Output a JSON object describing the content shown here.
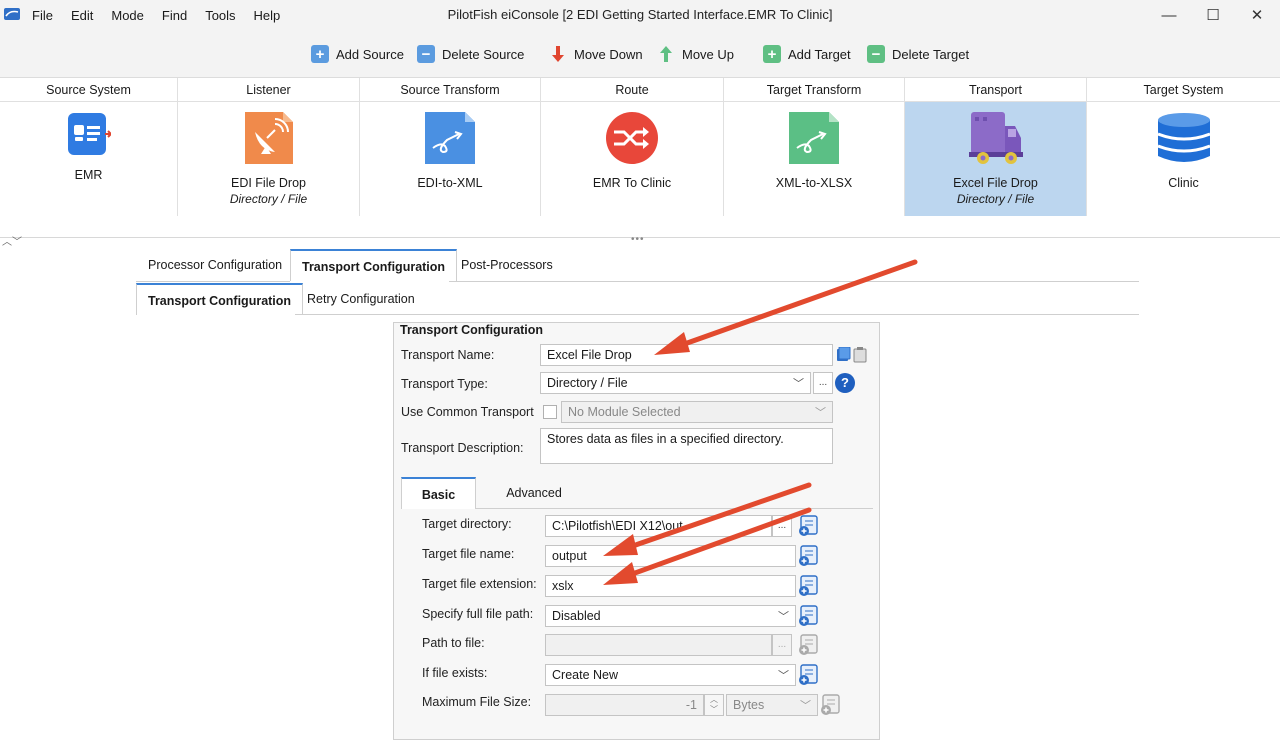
{
  "window": {
    "title": "PilotFish eiConsole [2 EDI Getting Started Interface.EMR To Clinic]",
    "minimize": "—",
    "maximize": "☐",
    "close": "✕"
  },
  "menu": [
    "File",
    "Edit",
    "Mode",
    "Find",
    "Tools",
    "Help"
  ],
  "toolbar": {
    "add_source": "Add Source",
    "delete_source": "Delete Source",
    "move_down": "Move Down",
    "move_up": "Move Up",
    "add_target": "Add Target",
    "delete_target": "Delete Target"
  },
  "stages": [
    {
      "header": "Source System",
      "name": "EMR",
      "sub": "",
      "icon": "contact-card-icon"
    },
    {
      "header": "Listener",
      "name": "EDI File Drop",
      "sub": "Directory / File",
      "icon": "satellite-dish-icon"
    },
    {
      "header": "Source Transform",
      "name": "EDI-to-XML",
      "sub": "",
      "icon": "transform-doc-icon"
    },
    {
      "header": "Route",
      "name": "EMR To Clinic",
      "sub": "",
      "icon": "route-arrows-icon"
    },
    {
      "header": "Target Transform",
      "name": "XML-to-XLSX",
      "sub": "",
      "icon": "transform-doc-icon"
    },
    {
      "header": "Transport",
      "name": "Excel File Drop",
      "sub": "Directory / File",
      "icon": "truck-icon"
    },
    {
      "header": "Target System",
      "name": "Clinic",
      "sub": "",
      "icon": "database-icon"
    }
  ],
  "tabs": {
    "processor": "Processor Configuration",
    "transport": "Transport Configuration",
    "post": "Post-Processors",
    "sub_transport": "Transport Configuration",
    "retry": "Retry Configuration"
  },
  "form": {
    "title": "Transport Configuration",
    "name_label": "Transport Name:",
    "name_value": "Excel File Drop",
    "type_label": "Transport Type:",
    "type_value": "Directory / File",
    "common_label": "Use Common Transport",
    "common_value": "No Module Selected",
    "desc_label": "Transport Description:",
    "desc_value": "Stores data as files in a specified directory.",
    "ellipsis": "...",
    "help": "?"
  },
  "inner_tabs": {
    "basic": "Basic",
    "advanced": "Advanced"
  },
  "basic": {
    "dir_label": "Target directory:",
    "dir_value": "C:\\Pilotfish\\EDI X12\\out",
    "fname_label": "Target file name:",
    "fname_value": "output",
    "ext_label": "Target file extension:",
    "ext_value": "xslx",
    "fullpath_label": "Specify full file path:",
    "fullpath_value": "Disabled",
    "path_label": "Path to file:",
    "path_value": "",
    "exists_label": "If file exists:",
    "exists_value": "Create New",
    "maxsize_label": "Maximum File Size:",
    "maxsize_value": "-1",
    "maxsize_unit": "Bytes"
  },
  "colors": {
    "accent": "#3b82d6",
    "selected_stage": "#bcd6ef",
    "arrow": "#e24a2e"
  }
}
